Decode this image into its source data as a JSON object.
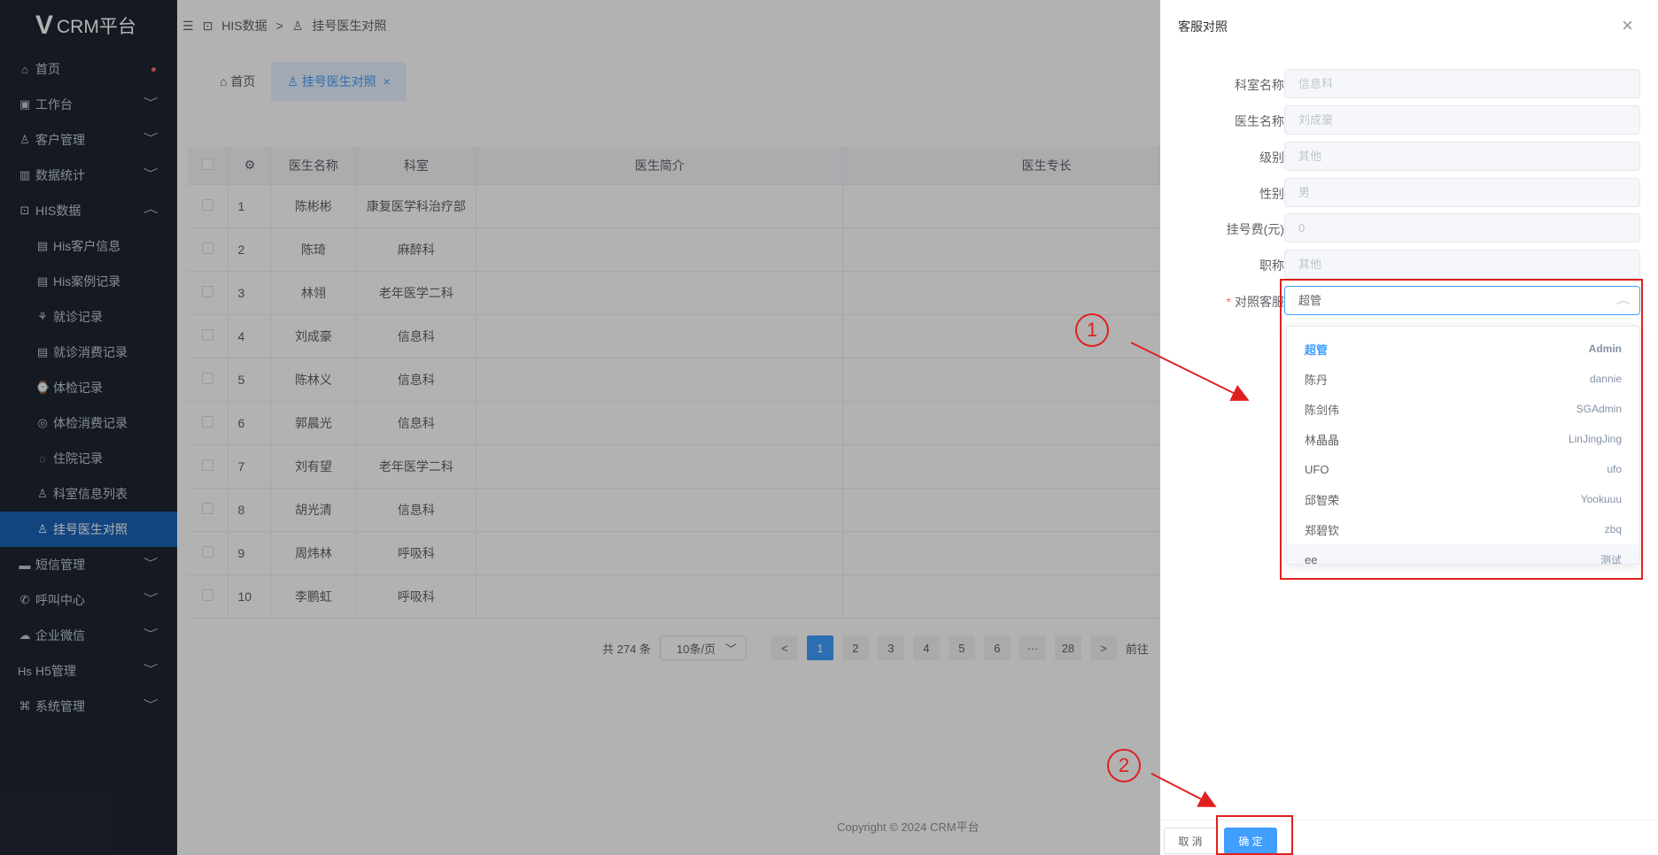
{
  "app": {
    "name": "CRM平台"
  },
  "sidebar": {
    "items": [
      {
        "label": "首页",
        "icon": "⌂"
      },
      {
        "label": "工作台",
        "icon": "▣"
      },
      {
        "label": "客户管理",
        "icon": "♙"
      },
      {
        "label": "数据统计",
        "icon": "▥"
      },
      {
        "label": "HIS数据",
        "icon": "⊡"
      },
      {
        "label": "His客户信息",
        "icon": "▤"
      },
      {
        "label": "His案例记录",
        "icon": "▤"
      },
      {
        "label": "就诊记录",
        "icon": "⚘"
      },
      {
        "label": "就诊消费记录",
        "icon": "▤"
      },
      {
        "label": "体检记录",
        "icon": "⌚"
      },
      {
        "label": "体检消费记录",
        "icon": "◎"
      },
      {
        "label": "住院记录",
        "icon": "◌"
      },
      {
        "label": "科室信息列表",
        "icon": "♙"
      },
      {
        "label": "挂号医生对照",
        "icon": "♙"
      },
      {
        "label": "短信管理",
        "icon": "▬"
      },
      {
        "label": "呼叫中心",
        "icon": "✆"
      },
      {
        "label": "企业微信",
        "icon": "☁"
      },
      {
        "label": "H5管理",
        "icon": "Hs"
      },
      {
        "label": "系统管理",
        "icon": "⌘"
      }
    ]
  },
  "header": {
    "breadcrumb": [
      "HIS数据",
      ">",
      "挂号医生对照"
    ]
  },
  "tabs": [
    {
      "label": "首页"
    },
    {
      "label": "挂号医生对照",
      "close": "×"
    }
  ],
  "table": {
    "columns": [
      "医生名称",
      "科室",
      "医生简介",
      "医生专长"
    ],
    "rows": [
      {
        "no": "1",
        "name": "陈彬彬",
        "dept": "康复医学科治疗部"
      },
      {
        "no": "2",
        "name": "陈琦",
        "dept": "麻醉科"
      },
      {
        "no": "3",
        "name": "林翎",
        "dept": "老年医学二科"
      },
      {
        "no": "4",
        "name": "刘成豪",
        "dept": "信息科"
      },
      {
        "no": "5",
        "name": "陈林义",
        "dept": "信息科"
      },
      {
        "no": "6",
        "name": "郭晨光",
        "dept": "信息科"
      },
      {
        "no": "7",
        "name": "刘有望",
        "dept": "老年医学二科"
      },
      {
        "no": "8",
        "name": "胡光清",
        "dept": "信息科"
      },
      {
        "no": "9",
        "name": "周炜林",
        "dept": "呼吸科"
      },
      {
        "no": "10",
        "name": "李鹏虹",
        "dept": "呼吸科"
      }
    ]
  },
  "pagination": {
    "total": "共 274 条",
    "page_size": "10条/页",
    "pages": [
      "1",
      "2",
      "3",
      "4",
      "5",
      "6",
      "···",
      "28"
    ],
    "prev": "<",
    "next": ">",
    "goto": "前往"
  },
  "footer": {
    "copyright": "Copyright © 2024 CRM平台"
  },
  "drawer": {
    "title": "客服对照",
    "close": "×",
    "fields": [
      {
        "label": "科室名称",
        "value": "信息科"
      },
      {
        "label": "医生名称",
        "value": "刘成豪"
      },
      {
        "label": "级别",
        "value": "其他"
      },
      {
        "label": "性别",
        "value": "男"
      },
      {
        "label": "挂号费(元)",
        "value": "0"
      },
      {
        "label": "职称",
        "value": "其他"
      }
    ],
    "select": {
      "required": "*",
      "label": "对照客服",
      "value": "超管",
      "arrow": "︿"
    },
    "options": [
      {
        "left": "超管",
        "right": "Admin"
      },
      {
        "left": "陈丹",
        "right": "dannie"
      },
      {
        "left": "陈剑伟",
        "right": "SGAdmin"
      },
      {
        "left": "林晶晶",
        "right": "LinJingJing"
      },
      {
        "left": "UFO",
        "right": "ufo"
      },
      {
        "left": "邱智荣",
        "right": "Yookuuu"
      },
      {
        "left": "郑碧钦",
        "right": "zbq"
      },
      {
        "left": "ee",
        "right": "测试"
      }
    ],
    "cancel": "取 消",
    "confirm": "确 定"
  },
  "annotations": {
    "step1": "1",
    "step2": "2",
    "color": "#e02020"
  }
}
